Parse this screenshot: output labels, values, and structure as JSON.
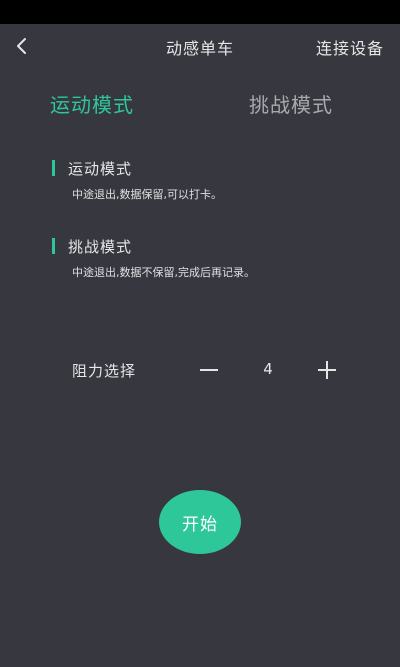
{
  "header": {
    "back_icon": "chevron-left-icon",
    "title": "动感单车",
    "connect_label": "连接设备"
  },
  "tabs": [
    {
      "label": "运动模式",
      "active": true
    },
    {
      "label": "挑战模式",
      "active": false
    }
  ],
  "modes": [
    {
      "title": "运动模式",
      "description": "中途退出,数据保留,可以打卡。"
    },
    {
      "title": "挑战模式",
      "description": "中途退出,数据不保留,完成后再记录。"
    }
  ],
  "resistance": {
    "label": "阻力选择",
    "value": "4",
    "minus_icon": "minus-icon",
    "plus_icon": "plus-icon"
  },
  "start_label": "开始",
  "colors": {
    "accent": "#2ec79a",
    "background": "#36373f",
    "text": "#e6e6e6",
    "inactive_tab": "#a8a8ad"
  }
}
